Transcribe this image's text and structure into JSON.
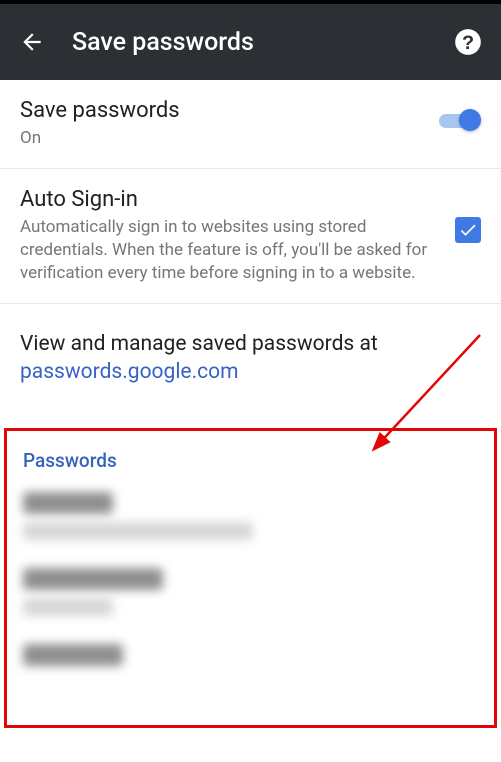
{
  "appbar": {
    "title": "Save passwords"
  },
  "savePasswords": {
    "title": "Save passwords",
    "status": "On",
    "enabled": true
  },
  "autoSignin": {
    "title": "Auto Sign-in",
    "description": "Automatically sign in to websites using stored credentials. When the feature is off, you'll be asked for verification every time before signing in to a website.",
    "checked": true
  },
  "manage": {
    "message": "View and manage saved passwords at ",
    "link": "passwords.google.com"
  },
  "passwords": {
    "header": "Passwords"
  }
}
